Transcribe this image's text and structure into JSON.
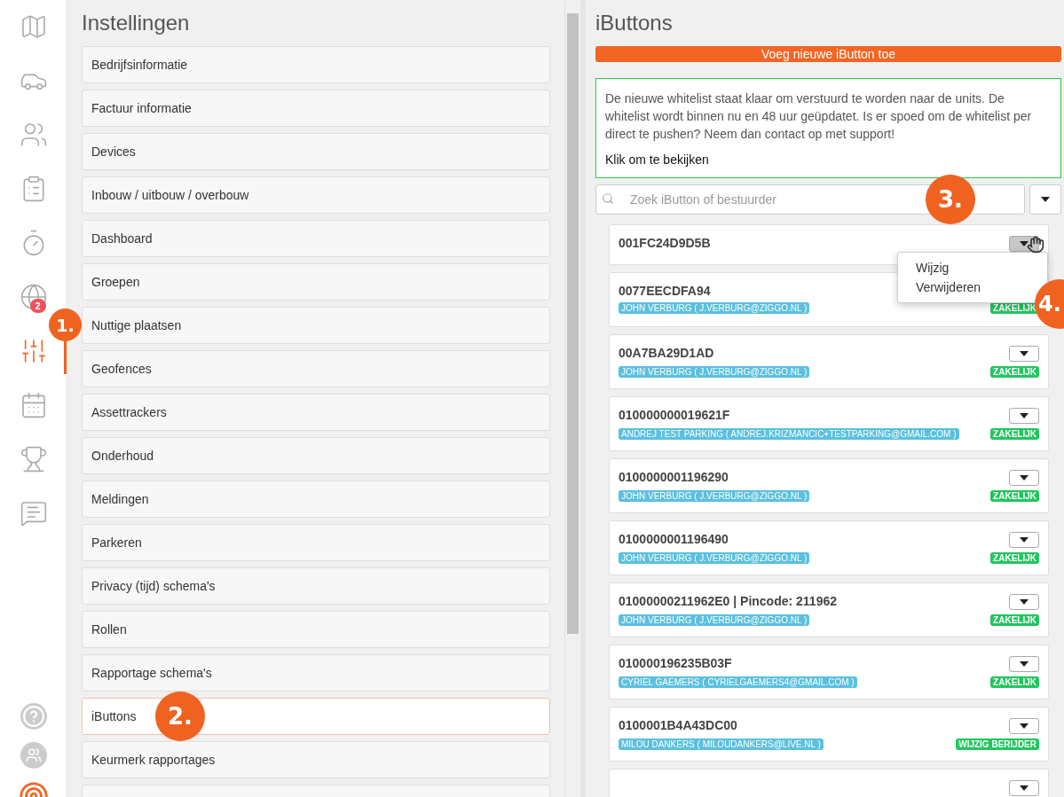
{
  "nav": {
    "items": [
      {
        "selected": false
      },
      {
        "selected": false
      },
      {
        "selected": false
      },
      {
        "selected": false
      },
      {
        "selected": false
      },
      {
        "selected": false,
        "badge": "2"
      },
      {
        "selected": true
      },
      {
        "selected": false
      },
      {
        "selected": false
      },
      {
        "selected": false
      }
    ]
  },
  "settings": {
    "title": "Instellingen",
    "items": [
      {
        "label": "Bedrijfsinformatie",
        "selected": false
      },
      {
        "label": "Factuur informatie",
        "selected": false
      },
      {
        "label": "Devices",
        "selected": false
      },
      {
        "label": "Inbouw / uitbouw / overbouw",
        "selected": false
      },
      {
        "label": "Dashboard",
        "selected": false
      },
      {
        "label": "Groepen",
        "selected": false
      },
      {
        "label": "Nuttige plaatsen",
        "selected": false
      },
      {
        "label": "Geofences",
        "selected": false
      },
      {
        "label": "Assettrackers",
        "selected": false
      },
      {
        "label": "Onderhoud",
        "selected": false
      },
      {
        "label": "Meldingen",
        "selected": false
      },
      {
        "label": "Parkeren",
        "selected": false
      },
      {
        "label": "Privacy (tijd) schema's",
        "selected": false
      },
      {
        "label": "Rollen",
        "selected": false
      },
      {
        "label": "Rapportage schema's",
        "selected": false
      },
      {
        "label": "iButtons",
        "selected": true
      },
      {
        "label": "Keurmerk rapportages",
        "selected": false
      },
      {
        "selected": false
      }
    ]
  },
  "ibuttons": {
    "title": "iButtons",
    "add_button": "Voeg nieuwe iButton toe",
    "notice": {
      "text": "De nieuwe whitelist staat klaar om verstuurd te worden naar de units. De whitelist wordt binnen nu en 48 uur geüpdatet. Is er spoed om de whitelist per direct te pushen? Neem dan contact op met support!",
      "link": "Klik om te bekijken"
    },
    "search": {
      "placeholder": "Zoek iButton of bestuurder"
    },
    "cards": [
      {
        "kind": "full",
        "id": "001FC24D9D5B",
        "menu_open": true,
        "menu": [
          "Wijzig",
          "Verwijderen"
        ]
      },
      {
        "kind": "full",
        "id": "0077EECDFA94",
        "driver": "JOHN VERBURG ( J.VERBURG@ZIGGO.NL )",
        "tag": "ZAKELIJK",
        "menu_open": false
      },
      {
        "kind": "full",
        "id": "00A7BA29D1AD",
        "driver": "JOHN VERBURG ( J.VERBURG@ZIGGO.NL )",
        "tag": "ZAKELIJK",
        "menu_open": false
      },
      {
        "kind": "full",
        "id": "010000000019621F",
        "driver": "ANDREJ TEST PARKING ( ANDREJ.KRIZMANCIC+TESTPARKING@GMAIL.COM )",
        "tag": "ZAKELIJK",
        "menu_open": false
      },
      {
        "kind": "full",
        "id": "0100000001196290",
        "driver": "JOHN VERBURG ( J.VERBURG@ZIGGO.NL )",
        "tag": "ZAKELIJK",
        "menu_open": false
      },
      {
        "kind": "full",
        "id": "0100000001196490",
        "driver": "JOHN VERBURG ( J.VERBURG@ZIGGO.NL )",
        "tag": "ZAKELIJK",
        "menu_open": false
      },
      {
        "kind": "full",
        "id": "01000000211962E0 | Pincode: 211962",
        "driver": "JOHN VERBURG ( J.VERBURG@ZIGGO.NL )",
        "tag": "ZAKELIJK",
        "menu_open": false
      },
      {
        "kind": "full",
        "id": "010000196235B03F",
        "driver": "CYRIEL GAEMERS ( CYRIELGAEMERS4@GMAIL.COM )",
        "tag": "ZAKELIJK",
        "menu_open": false
      },
      {
        "kind": "full",
        "id": "0100001B4A43DC00",
        "driver": "MILOU DANKERS ( MILOUDANKERS@LIVE.NL )",
        "tag": "WIJZIG BERIJDER",
        "menu_open": false
      },
      {
        "kind": "cut",
        "menu_open": false
      }
    ]
  },
  "annotations": [
    {
      "label": "1."
    },
    {
      "label": "2."
    },
    {
      "label": "3."
    },
    {
      "label": "4."
    }
  ]
}
